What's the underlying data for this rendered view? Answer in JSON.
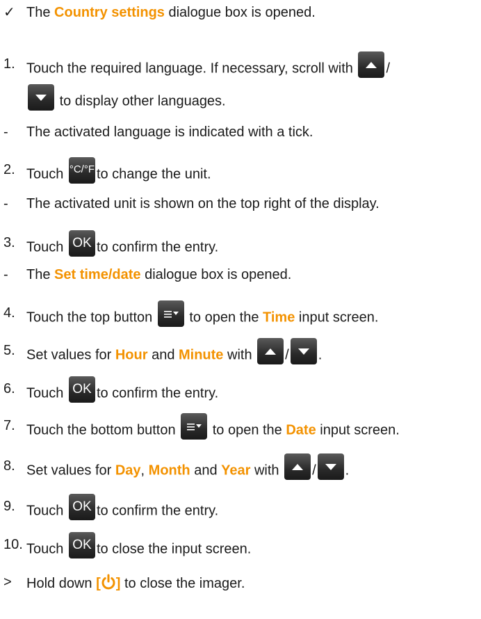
{
  "markers": {
    "check": "✓",
    "dash": "-",
    "result": ">"
  },
  "icons": {
    "up": "arrow-up-icon",
    "down": "arrow-down-icon",
    "unit": "celsius-fahrenheit-icon",
    "ok": "ok-button-icon",
    "menu": "menu-dropdown-icon",
    "power": "power-icon"
  },
  "button_labels": {
    "unit": "°C/°F",
    "ok": "OK"
  },
  "colors": {
    "highlight": "#f39200",
    "button": "#2a2a2a"
  },
  "steps": {
    "pre": {
      "a": "The ",
      "b": "Country settings",
      "c": " dialogue box is opened."
    },
    "s1": {
      "num": "1.",
      "a": "Touch the required language. If necessary, scroll with ",
      "sep": "/",
      "b": "to display other languages."
    },
    "r1": {
      "text": "The activated language is indicated with a tick."
    },
    "s2": {
      "num": "2.",
      "a": "Touch ",
      "b": "to change the unit."
    },
    "r2": {
      "text": "The activated unit is shown on the top right of the display."
    },
    "s3": {
      "num": "3.",
      "a": "Touch ",
      "b": "to confirm the entry."
    },
    "r3": {
      "a": "The ",
      "b": "Set time/date",
      "c": " dialogue box is opened."
    },
    "s4": {
      "num": "4.",
      "a": "Touch the top button ",
      "b": " to open the ",
      "c": "Time",
      "d": " input screen."
    },
    "s5": {
      "num": "5.",
      "a": "Set values for ",
      "b": "Hour",
      "c": " and ",
      "d": "Minute",
      "e": " with ",
      "sep": "/",
      "end": "."
    },
    "s6": {
      "num": "6.",
      "a": "Touch ",
      "b": "to confirm the entry."
    },
    "s7": {
      "num": "7.",
      "a": "Touch the bottom button ",
      "b": " to open the ",
      "c": "Date",
      "d": " input screen."
    },
    "s8": {
      "num": "8.",
      "a": "Set values for ",
      "b": "Day",
      "c": ", ",
      "d": "Month",
      "e": " and ",
      "f": "Year",
      "g": " with ",
      "sep": "/",
      "end": "."
    },
    "s9": {
      "num": "9.",
      "a": "Touch ",
      "b": "to confirm the entry."
    },
    "s10": {
      "num": "10.",
      "a": "Touch ",
      "b": "to close the input screen."
    },
    "final": {
      "a": "Hold down ",
      "open": "[",
      "close": "]",
      "b": " to close the imager."
    }
  }
}
